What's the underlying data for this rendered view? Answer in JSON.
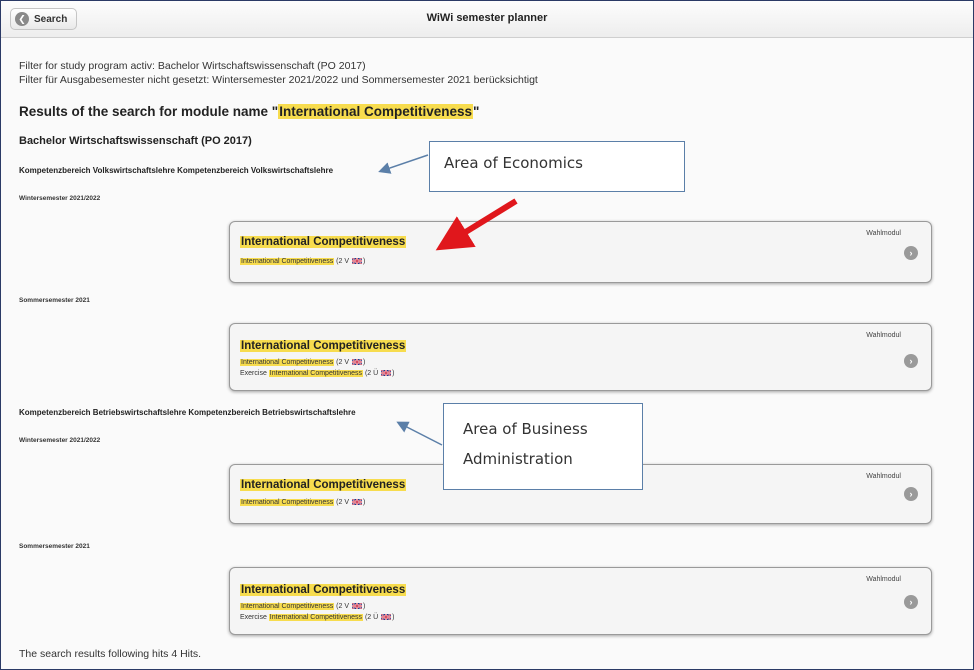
{
  "header": {
    "search_label": "Search",
    "title": "WiWi semester planner"
  },
  "filters": {
    "line1": "Filter for study program activ: Bachelor Wirtschaftswissenschaft (PO 2017)",
    "line2": "Filter für Ausgabesemester nicht gesetzt: Wintersemester 2021/2022 und Sommersemester 2021 berücksichtigt"
  },
  "results": {
    "prefix": "Results of the search for module name \"",
    "query": "International Competitiveness",
    "suffix": "\""
  },
  "program": "Bachelor Wirtschaftswissenschaft (PO 2017)",
  "areas": [
    {
      "title": "Kompetenzbereich Volkswirtschaftslehre Kompetenzbereich Volkswirtschaftslehre"
    },
    {
      "title": "Kompetenzbereich Betriebswirtschaftslehre Kompetenzbereich Betriebswirtschaftslehre"
    }
  ],
  "semesters": {
    "winter": "Wintersemester 2021/2022",
    "summer": "Sommersemester 2021"
  },
  "module": {
    "title": "International Competitiveness",
    "type": "Wahlmodul",
    "lecture_suffix": "(2 V",
    "exercise_prefix": "Exercise",
    "exercise_suffix": "(2 Ü",
    "close_paren": ")"
  },
  "callouts": {
    "economics": "Area of Economics",
    "business_line1": "Area of Business",
    "business_line2": "Administration"
  },
  "footer": "The search results following hits 4 Hits.",
  "colors": {
    "highlight": "#f7dc4e",
    "callout_border": "#5b7fa8",
    "red_arrow": "#e0171c",
    "blue_arrow": "#5b7fa8"
  }
}
